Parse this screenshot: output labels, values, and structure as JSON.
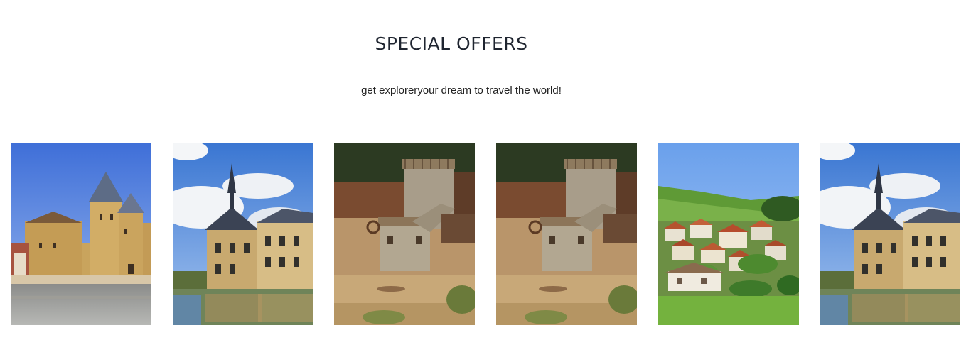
{
  "section": {
    "title": "SPECIAL OFFERS",
    "subtitle": "get exploreryour dream to travel the world!"
  },
  "gallery": {
    "items": [
      {
        "subject": "abbey-church"
      },
      {
        "subject": "chateau-on-water"
      },
      {
        "subject": "castle-construction"
      },
      {
        "subject": "castle-construction"
      },
      {
        "subject": "village-hillside"
      },
      {
        "subject": "chateau-on-water"
      }
    ]
  }
}
